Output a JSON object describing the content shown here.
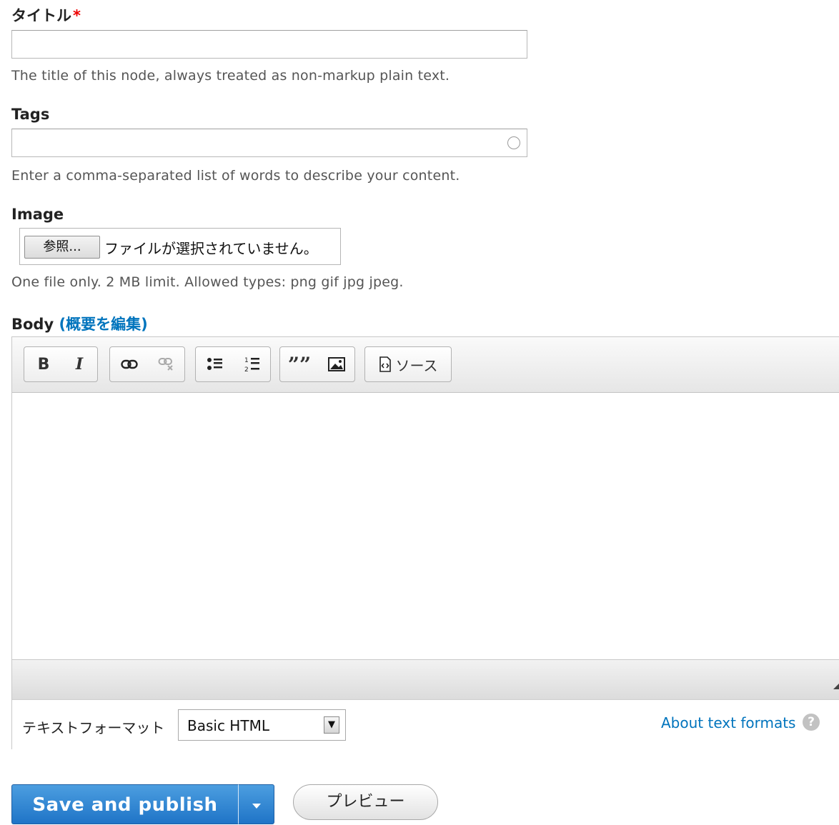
{
  "title_field": {
    "label": "タイトル",
    "required_marker": "*",
    "value": "",
    "description": "The title of this node, always treated as non-markup plain text."
  },
  "tags_field": {
    "label": "Tags",
    "value": "",
    "description": "Enter a comma-separated list of words to describe your content."
  },
  "image_field": {
    "label": "Image",
    "browse_button": "参照...",
    "status_text": "ファイルが選択されていません。",
    "description": "One file only. 2 MB limit. Allowed types: png gif jpg jpeg."
  },
  "body_field": {
    "label": "Body",
    "edit_summary_link": "(概要を編集)",
    "toolbar": {
      "bold": "B",
      "italic": "I",
      "source_label": "ソース"
    },
    "text_format": {
      "label": "テキストフォーマット",
      "selected": "Basic HTML",
      "about_link": "About text formats",
      "help_icon": "?"
    }
  },
  "actions": {
    "save_label": "Save and publish",
    "preview_label": "プレビュー"
  }
}
